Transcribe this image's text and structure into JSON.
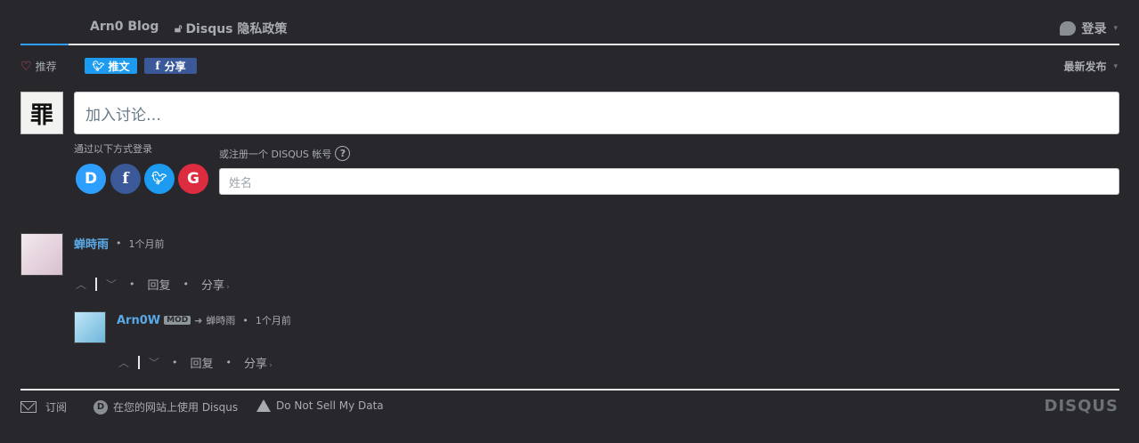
{
  "nav": {
    "tab1": "Arn0 Blog",
    "tab2": "Disqus 隐私政策",
    "login": "登录"
  },
  "toolbar": {
    "recommend": "推荐",
    "tweet": "推文",
    "share": "分享",
    "sort": "最新发布"
  },
  "composer": {
    "placeholder": "加入讨论…",
    "login_via": "通过以下方式登录",
    "register": "或注册一个 DISQUS 帐号",
    "name_placeholder": "姓名",
    "providers": [
      "disqus-icon",
      "facebook-icon",
      "twitter-icon",
      "google-icon"
    ]
  },
  "comments": [
    {
      "author": "蝉時雨",
      "time": "1个月前",
      "reply": "回复",
      "share": "分享"
    },
    {
      "author": "Arn0W",
      "badge": "MOD",
      "reply_to": "蝉時雨",
      "time": "1个月前",
      "reply": "回复",
      "share": "分享"
    }
  ],
  "footer": {
    "subscribe": "订阅",
    "use_disqus": "在您的网站上使用 Disqus",
    "do_not_sell": "Do Not Sell My Data",
    "logo": "DISQUS"
  },
  "colors": {
    "background": "#28282c",
    "accent": "#2e9fff",
    "author": "#5aa9e6",
    "twitter": "#1d9bf0",
    "facebook": "#3b5998",
    "google": "#dd2c3f"
  }
}
